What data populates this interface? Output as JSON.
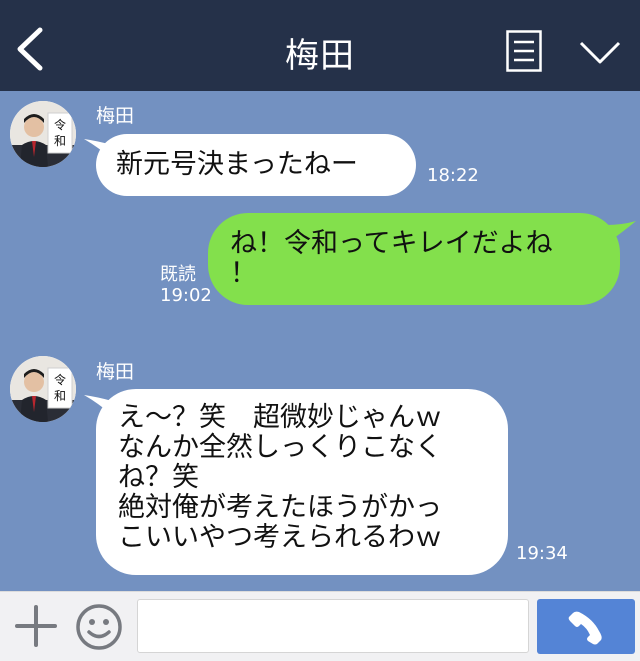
{
  "header": {
    "title": "梅田",
    "back_icon": "back-chevron-icon",
    "menu_icon": "notes-icon",
    "more_icon": "chevron-down-icon"
  },
  "avatar": {
    "card_text": [
      "令",
      "和"
    ]
  },
  "messages": [
    {
      "direction": "incoming",
      "sender": "梅田",
      "lines": [
        "新元号決まったねー"
      ],
      "time": "18:22"
    },
    {
      "direction": "outgoing",
      "read_label": "既読",
      "lines": [
        "ね！令和ってキレイだよね",
        "！"
      ],
      "time": "19:02"
    },
    {
      "direction": "incoming",
      "sender": "梅田",
      "lines": [
        "え～？笑　超微妙じゃんｗ",
        "なんか全然しっくりこなく",
        "ね？笑",
        "絶対俺が考えたほうがかっ",
        "こいいやつ考えられるわｗ"
      ],
      "time": "19:34"
    }
  ],
  "footer": {
    "input_placeholder": "",
    "plus_icon": "plus-icon",
    "emoji_icon": "emoji-icon",
    "call_icon": "phone-icon"
  },
  "colors": {
    "header_bg": "#253149",
    "chat_bg": "#7391c1",
    "outgoing_bubble": "#83e04c",
    "incoming_bubble": "#ffffff",
    "call_button": "#5484d6"
  }
}
